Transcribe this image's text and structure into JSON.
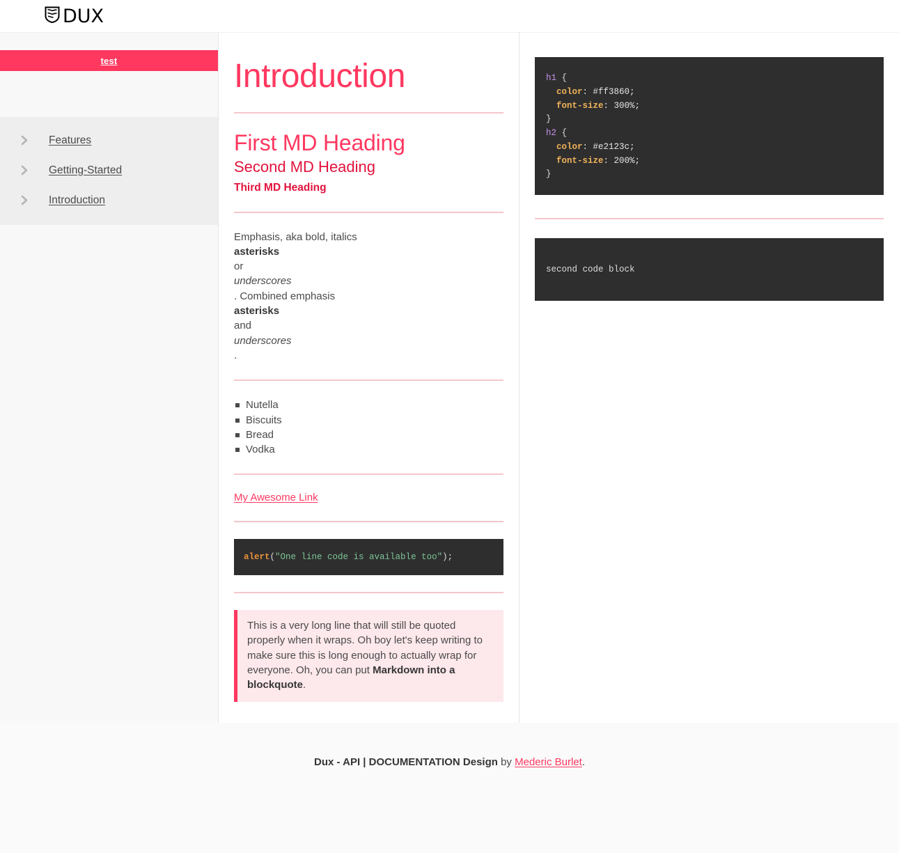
{
  "header": {
    "brand_text": "DUX",
    "brand_icon": "shield-crest-icon"
  },
  "sidebar": {
    "banner_label": "test",
    "items": [
      {
        "label": "Features",
        "icon": "chevron-right-icon"
      },
      {
        "label": "Getting-Started",
        "icon": "chevron-right-icon"
      },
      {
        "label": "Introduction",
        "icon": "chevron-right-icon"
      }
    ]
  },
  "main": {
    "page_title": "Introduction",
    "h1": "First MD Heading",
    "h2": "Second MD Heading",
    "h3": "Third MD Heading",
    "emphasis": {
      "line1": "Emphasis, aka bold, italics",
      "line2": "asterisks",
      "line3": "or",
      "line4": "underscores",
      "line5": ". Combined emphasis",
      "line6": "asterisks",
      "line7": "and",
      "line8": "underscores",
      "line9": "."
    },
    "list": [
      "Nutella",
      "Biscuits",
      "Bread",
      "Vodka"
    ],
    "link_label": "My Awesome Link",
    "inline_code": {
      "fn": "alert",
      "open": "(",
      "string": "\"One line code is available too\"",
      "close": ");"
    },
    "quote": {
      "text": "This is a very long line that will still be quoted properly when it wraps. Oh boy let's keep writing to make sure this is long enough to actually wrap for everyone. Oh, you can put",
      "bold": "Markdown into a blockquote",
      "tail": "."
    }
  },
  "aside": {
    "code_block_1": {
      "l1_sel": "h1",
      "l1_brace": " {",
      "l2_prop": "color",
      "l2_val": ": #ff3860;",
      "l3_prop": "font-size",
      "l3_val": ": 300%;",
      "l4_brace": "}",
      "l5_sel": "h2",
      "l5_brace": " {",
      "l6_prop": "color",
      "l6_val": ": #e2123c;",
      "l7_prop": "font-size",
      "l7_val": ": 200%;",
      "l8_brace": "}"
    },
    "code_block_2": "second code block"
  },
  "footer": {
    "strong": "Dux - API | DOCUMENTATION Design",
    "by": " by ",
    "link": "Mederic Burlet",
    "period": "."
  },
  "colors": {
    "accent": "#ff3860",
    "accent_dark": "#e2123c",
    "rule": "#f5c6cb",
    "code_bg": "#2e2e2e",
    "quote_bg": "#fde8ec",
    "sidebar_bg": "#f8f8f8",
    "nav_bg": "#eeeeee",
    "footer_bg": "#fafafa"
  }
}
